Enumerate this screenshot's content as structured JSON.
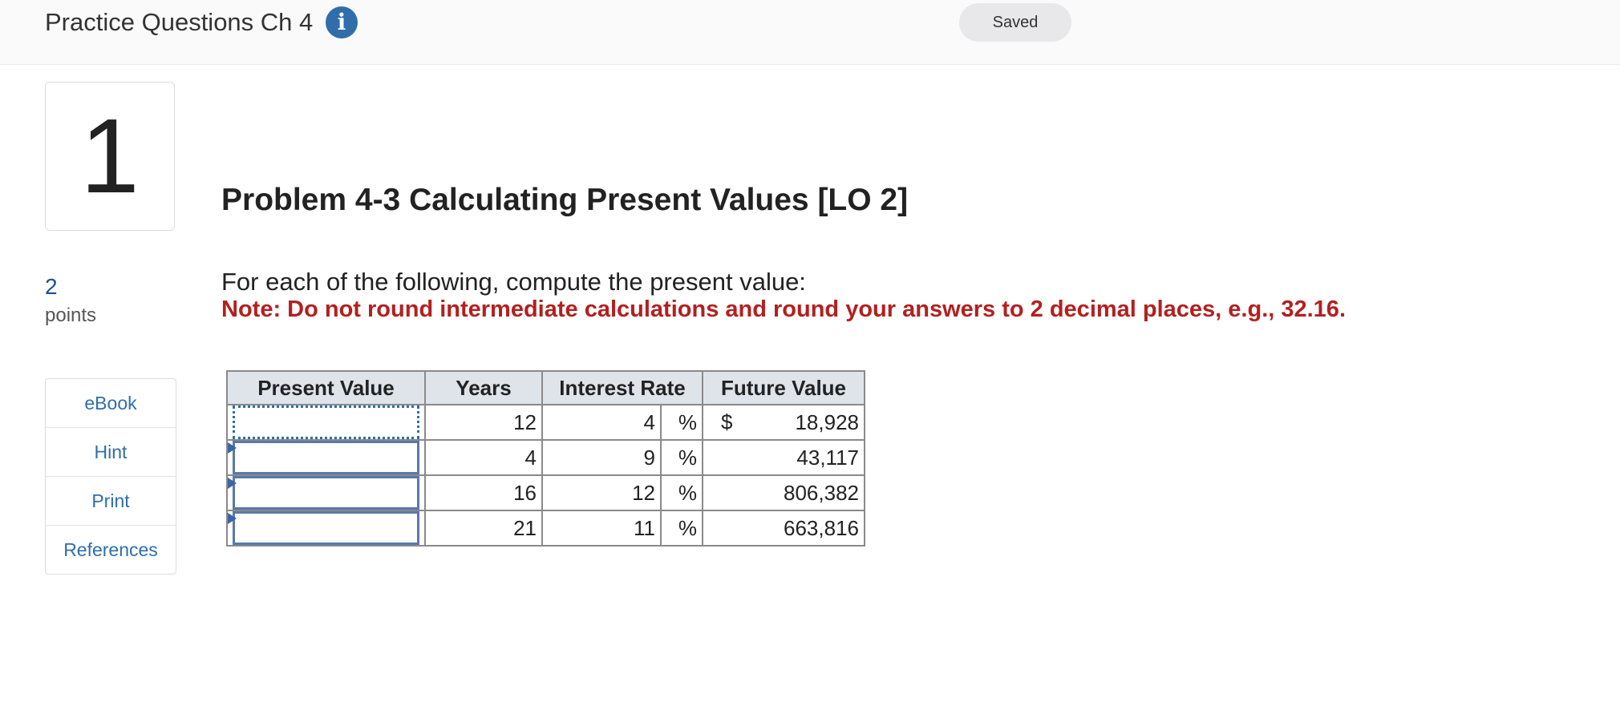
{
  "header": {
    "title": "Practice Questions Ch 4",
    "info_icon": "info-icon",
    "status": "Saved"
  },
  "question": {
    "number": "1",
    "points_value": "2",
    "points_label": "points"
  },
  "side_menu": {
    "items": [
      {
        "label": "eBook"
      },
      {
        "label": "Hint"
      },
      {
        "label": "Print"
      },
      {
        "label": "References"
      }
    ]
  },
  "problem": {
    "title": "Problem 4-3 Calculating Present Values [LO 2]",
    "instruction": "For each of the following, compute the present value:",
    "note": "Note: Do not round intermediate calculations and round your answers to 2 decimal places, e.g., 32.16."
  },
  "table": {
    "headers": {
      "present_value": "Present Value",
      "years": "Years",
      "interest_rate": "Interest Rate",
      "future_value": "Future Value"
    },
    "rows": [
      {
        "present_value": "",
        "years": "12",
        "rate": "4",
        "pct": "%",
        "currency": "$",
        "future_value": "18,928"
      },
      {
        "present_value": "",
        "years": "4",
        "rate": "9",
        "pct": "%",
        "currency": "",
        "future_value": "43,117"
      },
      {
        "present_value": "",
        "years": "16",
        "rate": "12",
        "pct": "%",
        "currency": "",
        "future_value": "806,382"
      },
      {
        "present_value": "",
        "years": "21",
        "rate": "11",
        "pct": "%",
        "currency": "",
        "future_value": "663,816"
      }
    ]
  },
  "colors": {
    "accent_blue": "#2f6eaa",
    "note_red": "#b3201f",
    "header_bg": "#dfe3ea"
  }
}
